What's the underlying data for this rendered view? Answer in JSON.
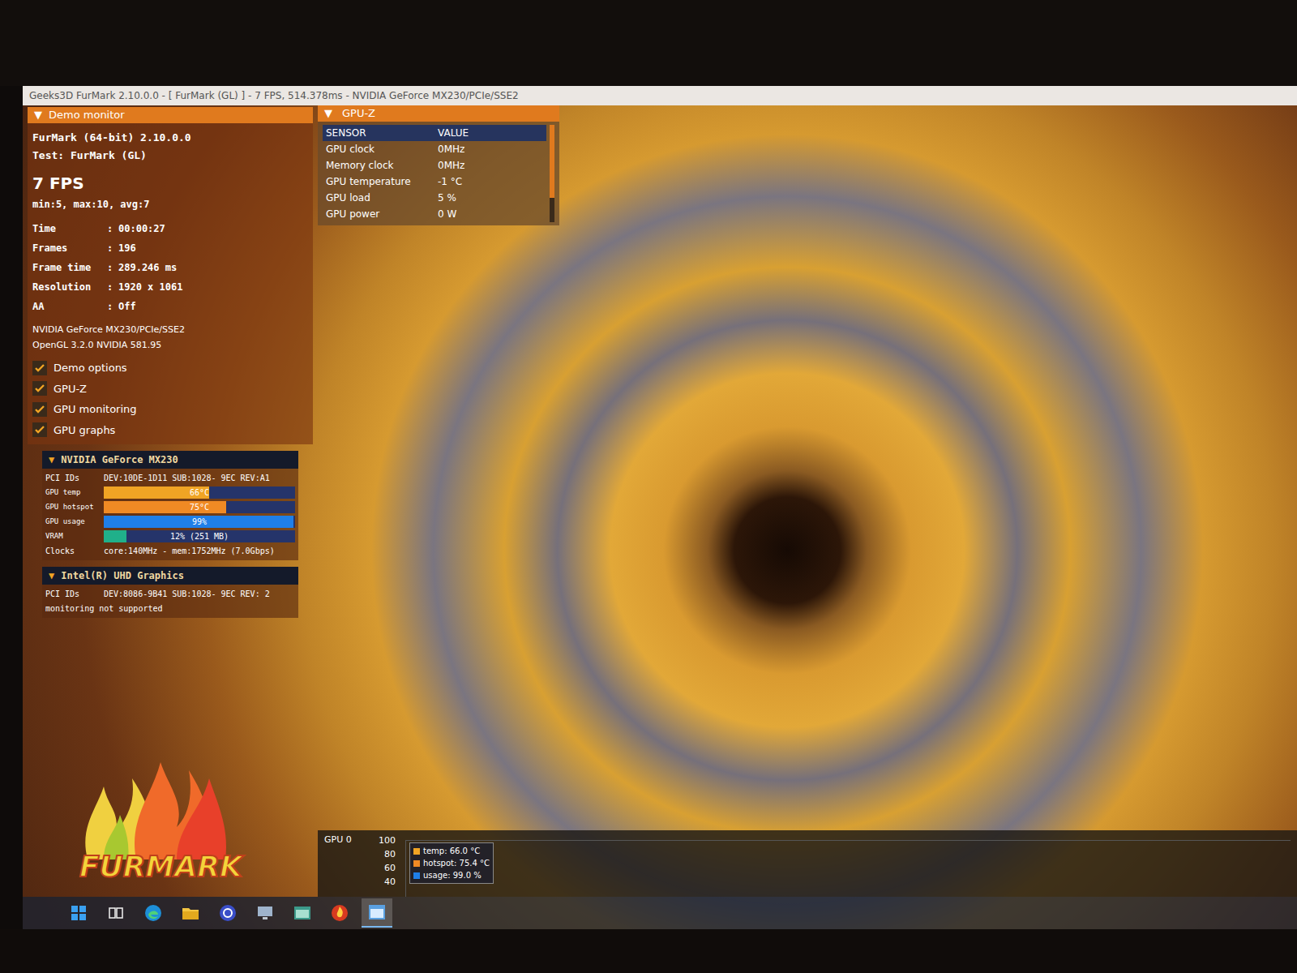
{
  "window": {
    "title": "Geeks3D FurMark 2.10.0.0 - [ FurMark (GL) ] - 7 FPS, 514.378ms - NVIDIA GeForce MX230/PCIe/SSE2"
  },
  "demo_monitor": {
    "arrow": "▼",
    "title": "Demo monitor",
    "app": "FurMark (64-bit) 2.10.0.0",
    "test": "Test: FurMark (GL)",
    "fps": "7 FPS",
    "fps_stats": "min:5, max:10, avg:7",
    "separator": ":",
    "stats": [
      {
        "label": "Time",
        "value": "00:00:27"
      },
      {
        "label": "Frames",
        "value": "196"
      },
      {
        "label": "Frame time",
        "value": "289.246 ms"
      },
      {
        "label": "Resolution",
        "value": "1920 x 1061"
      },
      {
        "label": "AA",
        "value": "Off"
      }
    ],
    "renderer": "NVIDIA GeForce MX230/PCIe/SSE2",
    "api": "OpenGL 3.2.0 NVIDIA 581.95",
    "options": [
      {
        "label": "Demo options",
        "checked": true
      },
      {
        "label": "GPU-Z",
        "checked": true
      },
      {
        "label": "GPU monitoring",
        "checked": true
      },
      {
        "label": "GPU graphs",
        "checked": true
      }
    ]
  },
  "gpus": [
    {
      "arrow": "▼",
      "name": "NVIDIA GeForce MX230",
      "pci_label": "PCI IDs",
      "pci": "DEV:10DE-1D11 SUB:1028- 9EC REV:A1",
      "meters": [
        {
          "label": "GPU temp",
          "reading": "66°C",
          "level": 0.55,
          "color": "#f0a424"
        },
        {
          "label": "GPU hotspot",
          "reading": "75°C",
          "level": 0.64,
          "color": "#f08a24"
        },
        {
          "label": "GPU usage",
          "reading": "99%",
          "level": 0.99,
          "color": "#1f7fe8"
        },
        {
          "label": "VRAM",
          "reading": "12% (251 MB)",
          "level": 0.12,
          "color": "#20b08a"
        }
      ],
      "clocks_label": "Clocks",
      "clocks": "core:140MHz - mem:1752MHz (7.0Gbps)",
      "note": ""
    },
    {
      "arrow": "▼",
      "name": "Intel(R) UHD Graphics",
      "pci_label": "PCI IDs",
      "pci": "DEV:8086-9B41 SUB:1028- 9EC REV: 2",
      "meters": [],
      "clocks_label": "",
      "clocks": "",
      "note": "monitoring not supported"
    }
  ],
  "gpu_z": {
    "arrow": "▼",
    "title": "GPU-Z",
    "columns": [
      "SENSOR",
      "VALUE"
    ],
    "rows": [
      [
        "GPU clock",
        "0MHz"
      ],
      [
        "Memory clock",
        "0MHz"
      ],
      [
        "GPU temperature",
        "-1 °C"
      ],
      [
        "GPU load",
        "5 %"
      ],
      [
        "GPU power",
        "0 W"
      ]
    ]
  },
  "graph": {
    "label": "GPU 0",
    "ticks": [
      "100",
      "80",
      "60",
      "40"
    ],
    "legend": [
      {
        "text": "temp: 66.0 °C",
        "color": "#f0a424"
      },
      {
        "text": "hotspot: 75.4 °C",
        "color": "#f08a24"
      },
      {
        "text": "usage: 99.0 %",
        "color": "#1f7fe8"
      }
    ]
  },
  "logo": {
    "text": "FURMARK"
  },
  "taskbar": {
    "items": [
      {
        "selected": false
      },
      {
        "selected": false
      },
      {
        "selected": false
      },
      {
        "selected": false
      },
      {
        "selected": false
      },
      {
        "selected": false
      },
      {
        "selected": false
      },
      {
        "selected": false
      },
      {
        "selected": true
      }
    ]
  }
}
